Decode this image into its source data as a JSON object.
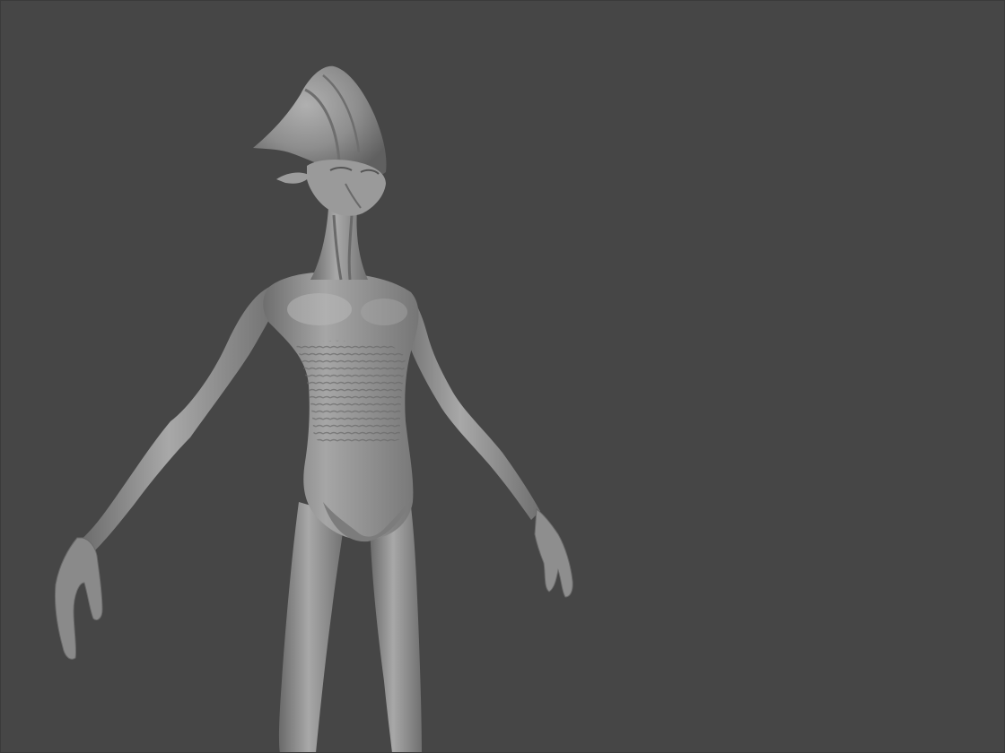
{
  "viewport": {
    "background_color": "#464646",
    "model": {
      "subject": "alien-figure-sculpt",
      "material_color": "#8c8c8c",
      "shade_color": "#5e5e5e",
      "highlight_color": "#b4b4b4"
    }
  }
}
